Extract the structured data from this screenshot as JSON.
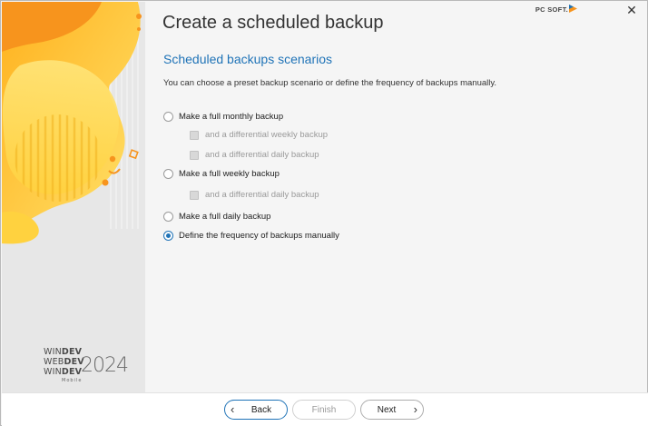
{
  "window": {
    "title": "Create a scheduled backup",
    "vendor_logo": "PC SOFT.",
    "close_symbol": "✕"
  },
  "branding": {
    "line1_prefix": "WIN",
    "line1_suffix": "DEV",
    "line2_prefix": "WEB",
    "line2_suffix": "DEV",
    "line3_prefix": "WIN",
    "line3_suffix": "DEV",
    "mobile": "Mobile",
    "year": "2024"
  },
  "main": {
    "section_title": "Scheduled backups scenarios",
    "intro": "You can choose a preset backup scenario or define the frequency of backups manually.",
    "options": [
      {
        "label": "Make a full monthly backup",
        "selected": false
      },
      {
        "label": "Make a full weekly backup",
        "selected": false
      },
      {
        "label": "Make a full daily backup",
        "selected": false
      },
      {
        "label": "Define the frequency of backups manually",
        "selected": true
      }
    ],
    "sub_options": {
      "monthly_weekly": "and a differential weekly backup",
      "monthly_daily": "and a differential daily backup",
      "weekly_daily": "and a differential daily backup"
    }
  },
  "footer": {
    "back_label": "Back",
    "finish_label": "Finish",
    "next_label": "Next"
  },
  "colors": {
    "accent": "#1f73b7",
    "panel_yellow": "#ffd84d",
    "panel_orange": "#f7941d"
  }
}
